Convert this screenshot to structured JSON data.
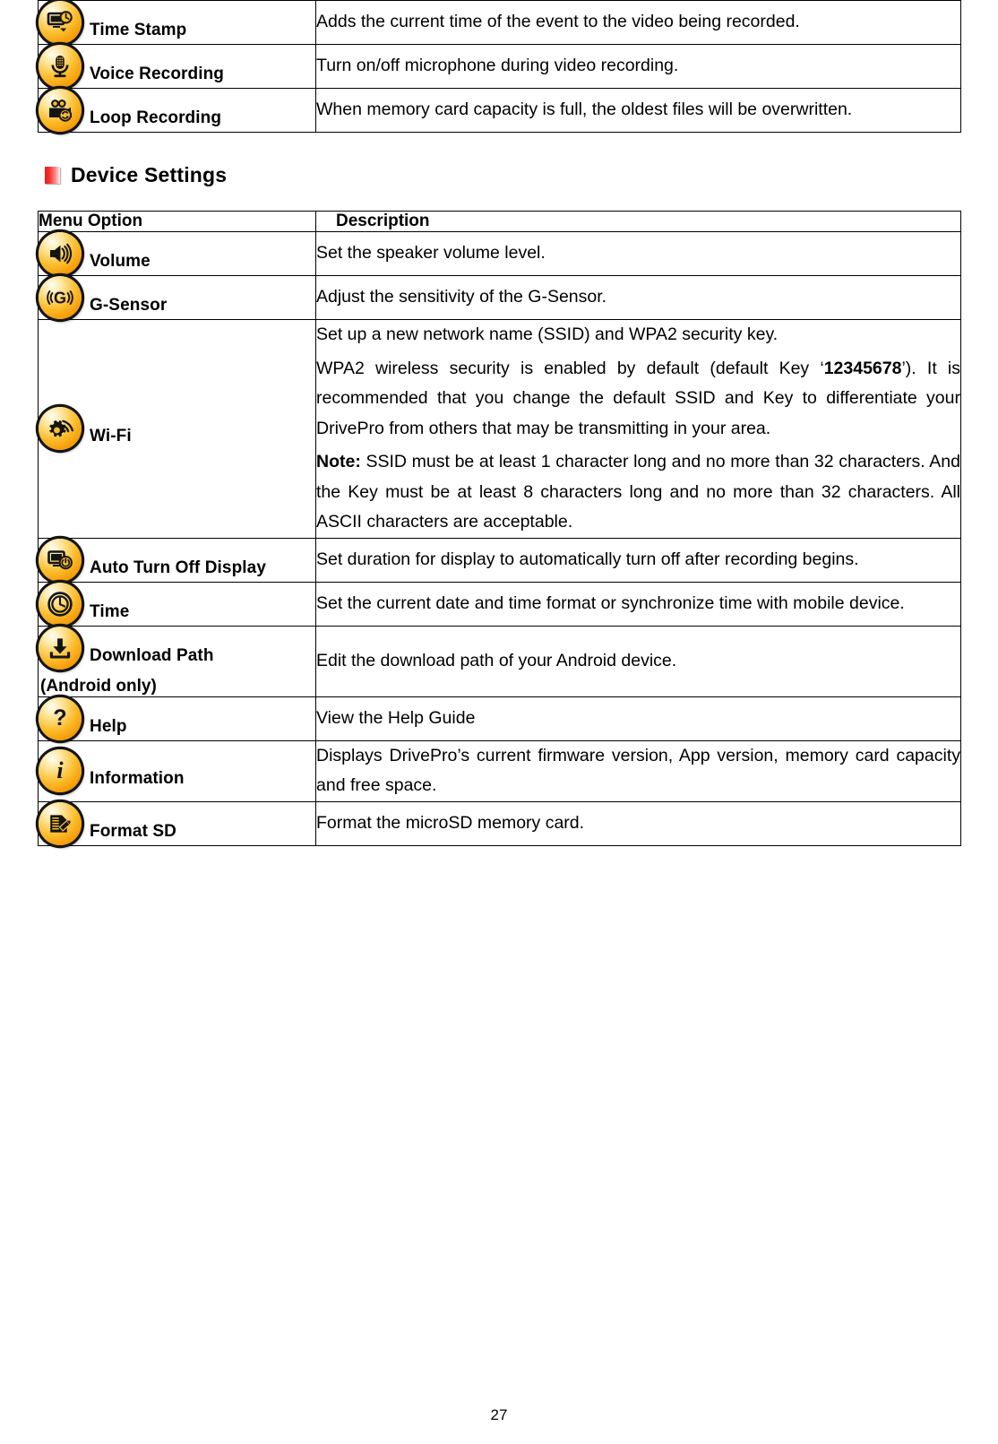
{
  "document": {
    "page_number": "27"
  },
  "top_table": {
    "rows": [
      {
        "icon": "time-stamp-icon",
        "label": "Time Stamp",
        "description": "Adds the current time of the event to the video being recorded."
      },
      {
        "icon": "voice-recording-icon",
        "label": "Voice Recording",
        "description": "Turn on/off microphone during video recording."
      },
      {
        "icon": "loop-recording-icon",
        "label": "Loop Recording",
        "description": "When memory card capacity is full, the oldest files will be overwritten."
      }
    ]
  },
  "section": {
    "title": "Device Settings",
    "bullet_color": "#ee1b1b"
  },
  "device_table": {
    "headers": {
      "option": "Menu Option",
      "description": "Description"
    },
    "rows": [
      {
        "icon": "volume-icon",
        "label": "Volume",
        "sublabel": "",
        "description": "Set the speaker volume level."
      },
      {
        "icon": "g-sensor-icon",
        "label": "G-Sensor",
        "sublabel": "",
        "description": "Adjust the sensitivity of the G-Sensor."
      },
      {
        "icon": "wifi-icon",
        "label": "Wi-Fi",
        "sublabel": "",
        "description_paragraphs": [
          "Set up a new network name (SSID) and WPA2 security key.",
          "WPA2 wireless security is enabled by default (default Key ‘12345678’). It is recommended that you change the default SSID and Key to differentiate your DrivePro from others that may be transmitting in your area.",
          "Note: SSID must be at least 1 character long and no more than 32 characters. And the Key must be at least 8 characters long and no more than 32 characters. All ASCII characters are acceptable."
        ],
        "bold_default_key": "12345678",
        "bold_note_label": "Note:"
      },
      {
        "icon": "auto-turn-off-display-icon",
        "label": "Auto Turn Off Display",
        "sublabel": "",
        "description": "Set duration for display to automatically turn off after recording begins."
      },
      {
        "icon": "time-icon",
        "label": "Time",
        "sublabel": "",
        "description": "Set the current date and time format or synchronize time with mobile device."
      },
      {
        "icon": "download-path-icon",
        "label": "Download Path",
        "sublabel": "(Android only)",
        "description": "Edit the download path of your Android device."
      },
      {
        "icon": "help-icon",
        "label": "Help",
        "sublabel": "",
        "description": "View the Help Guide"
      },
      {
        "icon": "information-icon",
        "label": "Information",
        "sublabel": "",
        "description": "Displays DrivePro’s current firmware version, App version, memory card capacity and free space."
      },
      {
        "icon": "format-sd-icon",
        "label": "Format SD",
        "sublabel": "",
        "description": "Format the microSD memory card."
      }
    ]
  }
}
